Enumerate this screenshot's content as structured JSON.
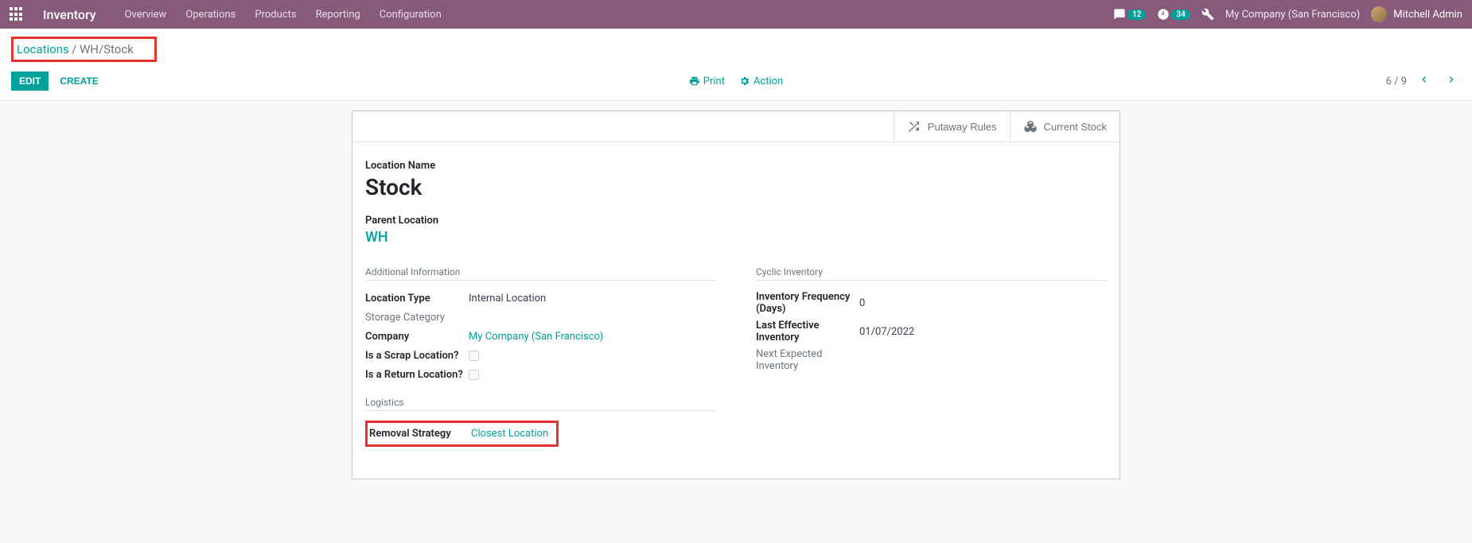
{
  "navbar": {
    "app_name": "Inventory",
    "menu": [
      "Overview",
      "Operations",
      "Products",
      "Reporting",
      "Configuration"
    ],
    "msg_count": "12",
    "activity_count": "34",
    "company": "My Company (San Francisco)",
    "user": "Mitchell Admin"
  },
  "breadcrumb": {
    "parent": "Locations",
    "current": "WH/Stock"
  },
  "cp": {
    "edit": "EDIT",
    "create": "CREATE",
    "print": "Print",
    "action": "Action",
    "pager": "6 / 9"
  },
  "statbuttons": {
    "putaway": "Putaway Rules",
    "current_stock": "Current Stock"
  },
  "form": {
    "location_name_label": "Location Name",
    "location_name": "Stock",
    "parent_location_label": "Parent Location",
    "parent_location": "WH",
    "sections": {
      "additional": "Additional Information",
      "logistics": "Logistics",
      "cyclic": "Cyclic Inventory"
    },
    "fields": {
      "location_type_label": "Location Type",
      "location_type": "Internal Location",
      "storage_category_label": "Storage Category",
      "company_label": "Company",
      "company": "My Company (San Francisco)",
      "scrap_label": "Is a Scrap Location?",
      "return_label": "Is a Return Location?",
      "removal_label": "Removal Strategy",
      "removal_value": "Closest Location",
      "inv_freq_label": "Inventory Frequency (Days)",
      "inv_freq": "0",
      "last_eff_label": "Last Effective Inventory",
      "last_eff": "01/07/2022",
      "next_exp_label": "Next Expected Inventory"
    }
  }
}
